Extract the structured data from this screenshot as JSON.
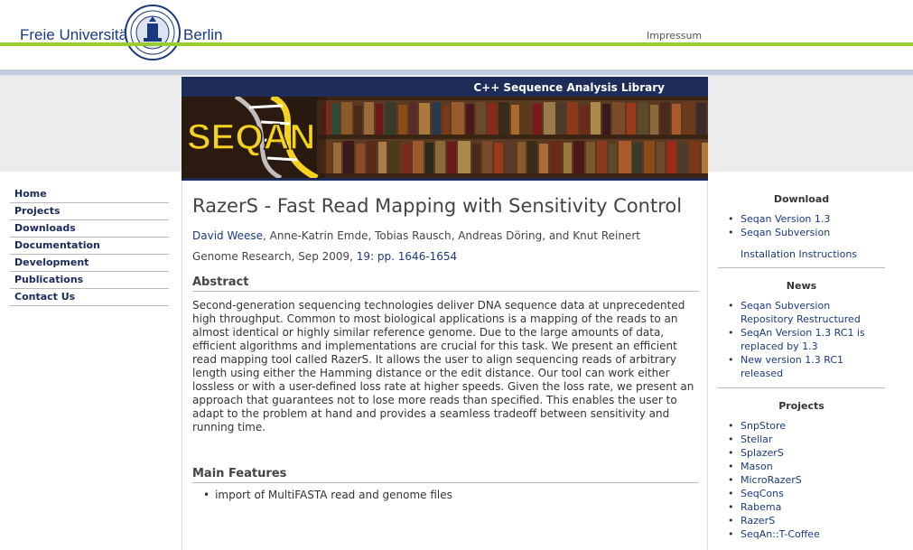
{
  "header": {
    "university_left": "Freie Universität",
    "university_right": "Berlin",
    "impressum": "Impressum"
  },
  "banner": {
    "title": "C++ Sequence Analysis Library",
    "logo_text": "SEQAN"
  },
  "leftnav": {
    "items": [
      {
        "label": "Home"
      },
      {
        "label": "Projects"
      },
      {
        "label": "Downloads"
      },
      {
        "label": "Documentation"
      },
      {
        "label": "Development"
      },
      {
        "label": "Publications"
      },
      {
        "label": "Contact Us"
      }
    ]
  },
  "main": {
    "title": "RazerS - Fast Read Mapping with Sensitivity Control",
    "first_author": "David Weese",
    "other_authors": ", Anne-Katrin Emde, Tobias Rausch, Andreas Döring, and Knut Reinert",
    "journal": "Genome Research, Sep 2009, ",
    "journal_link": "19: pp. 1646-1654",
    "abstract_heading": "Abstract",
    "abstract_text": "Second-generation sequencing technologies deliver DNA sequence data at unprecedented high throughput. Common to most biological applications is a mapping of the reads to an almost identical or highly similar reference genome. Due to the large amounts of data, efficient algorithms and implementations are crucial for this task. We present an efficient read mapping tool called RazerS. It allows the user to align sequencing reads of arbitrary length using either the Hamming distance or the edit distance. Our tool can work either lossless or with a user-defined loss rate at higher speeds. Given the loss rate, we present an approach that guarantees not to lose more reads than specified. This enables the user to adapt to the problem at hand and provides a seamless tradeoff between sensitivity and running time.",
    "features_heading": "Main Features",
    "features": [
      "import of MultiFASTA read and genome files"
    ]
  },
  "rightbar": {
    "download_heading": "Download",
    "download_items": [
      "Seqan Version 1.3",
      "Seqan Subversion"
    ],
    "install_link": "Installation Instructions",
    "news_heading": "News",
    "news_items": [
      "Seqan Subversion Repository Restructured",
      "SeqAn Version 1.3 RC1 is replaced by 1.3",
      "New version 1.3 RC1 released"
    ],
    "projects_heading": "Projects",
    "project_items": [
      "SnpStore",
      "Stellar",
      "SplazerS",
      "Mason",
      "MicroRazerS",
      "SeqCons",
      "Rabema",
      "RazerS",
      "SeqAn::T-Coffee"
    ]
  },
  "colors": {
    "link": "#1a3a80",
    "green_line": "#99cc33",
    "banner_bg": "#1e2c5a",
    "logo_yellow": "#f5d21e"
  }
}
